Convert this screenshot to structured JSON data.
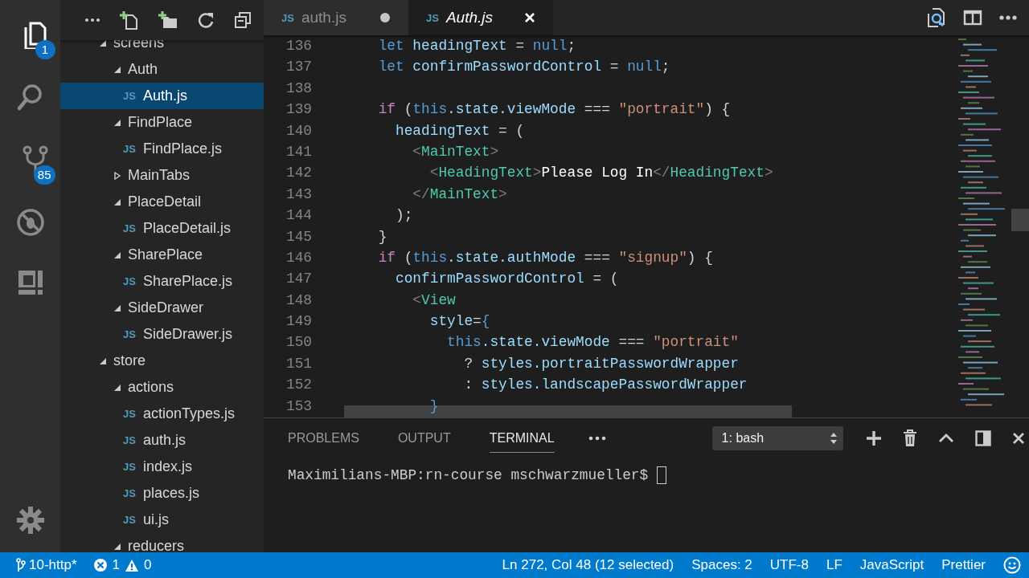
{
  "activity_bar": {
    "items": [
      {
        "kind": "explorer",
        "selected": true,
        "badge": "1"
      },
      {
        "kind": "search",
        "selected": false
      },
      {
        "kind": "source-control",
        "selected": false,
        "badge": "85"
      },
      {
        "kind": "debug",
        "selected": false
      },
      {
        "kind": "extensions",
        "selected": false
      }
    ]
  },
  "tree": [
    {
      "label": "screens",
      "kind": "folder",
      "expanded": true,
      "selected": false,
      "children": [
        {
          "label": "Auth",
          "kind": "folder",
          "expanded": true,
          "selected": false,
          "children": [
            {
              "label": "Auth.js",
              "kind": "file",
              "icon_label": "JS",
              "selected": true
            }
          ]
        },
        {
          "label": "FindPlace",
          "kind": "folder",
          "expanded": true,
          "selected": false,
          "children": [
            {
              "label": "FindPlace.js",
              "kind": "file",
              "icon_label": "JS",
              "selected": false
            }
          ]
        },
        {
          "label": "MainTabs",
          "kind": "folder",
          "expanded": false,
          "selected": false
        },
        {
          "label": "PlaceDetail",
          "kind": "folder",
          "expanded": true,
          "selected": false,
          "children": [
            {
              "label": "PlaceDetail.js",
              "kind": "file",
              "icon_label": "JS",
              "selected": false
            }
          ]
        },
        {
          "label": "SharePlace",
          "kind": "folder",
          "expanded": true,
          "selected": false,
          "children": [
            {
              "label": "SharePlace.js",
              "kind": "file",
              "icon_label": "JS",
              "selected": false
            }
          ]
        },
        {
          "label": "SideDrawer",
          "kind": "folder",
          "expanded": true,
          "selected": false,
          "children": [
            {
              "label": "SideDrawer.js",
              "kind": "file",
              "icon_label": "JS",
              "selected": false
            }
          ]
        }
      ]
    },
    {
      "label": "store",
      "kind": "folder",
      "expanded": true,
      "selected": false,
      "children": [
        {
          "label": "actions",
          "kind": "folder",
          "expanded": true,
          "selected": false,
          "children": [
            {
              "label": "actionTypes.js",
              "kind": "file",
              "icon_label": "JS",
              "selected": false
            },
            {
              "label": "auth.js",
              "kind": "file",
              "icon_label": "JS",
              "selected": false
            },
            {
              "label": "index.js",
              "kind": "file",
              "icon_label": "JS",
              "selected": false
            },
            {
              "label": "places.js",
              "kind": "file",
              "icon_label": "JS",
              "selected": false
            },
            {
              "label": "ui.js",
              "kind": "file",
              "icon_label": "JS",
              "selected": false
            }
          ]
        },
        {
          "label": "reducers",
          "kind": "folder",
          "expanded": true,
          "selected": false
        }
      ]
    }
  ],
  "editor_tabs": [
    {
      "label": "auth.js",
      "icon_label": "JS",
      "selected": false,
      "dirty": true,
      "preview": false
    },
    {
      "label": "Auth.js",
      "icon_label": "JS",
      "selected": true,
      "dirty": false,
      "preview": true
    }
  ],
  "code_lines": [
    {
      "number": "136",
      "tokens": [
        {
          "text": "    let",
          "kind": "keyword"
        },
        {
          "text": " headingText",
          "kind": "var"
        },
        {
          "text": " = ",
          "kind": "plain"
        },
        {
          "text": "null",
          "kind": "keyword"
        },
        {
          "text": ";",
          "kind": "plain"
        }
      ]
    },
    {
      "number": "137",
      "tokens": [
        {
          "text": "    let",
          "kind": "keyword"
        },
        {
          "text": " confirmPasswordControl",
          "kind": "var"
        },
        {
          "text": " = ",
          "kind": "plain"
        },
        {
          "text": "null",
          "kind": "keyword"
        },
        {
          "text": ";",
          "kind": "plain"
        }
      ]
    },
    {
      "number": "138"
    },
    {
      "number": "139",
      "tokens": [
        {
          "text": "    if",
          "kind": "control"
        },
        {
          "text": " (",
          "kind": "plain"
        },
        {
          "text": "this",
          "kind": "keyword"
        },
        {
          "text": ".state.viewMode",
          "kind": "var"
        },
        {
          "text": " === ",
          "kind": "plain"
        },
        {
          "text": "\"portrait\"",
          "kind": "string"
        },
        {
          "text": ") {",
          "kind": "plain"
        }
      ]
    },
    {
      "number": "140",
      "tokens": [
        {
          "text": "      headingText",
          "kind": "var"
        },
        {
          "text": " = (",
          "kind": "plain"
        }
      ]
    },
    {
      "number": "141",
      "tokens": [
        {
          "text": "        <",
          "kind": "bracket"
        },
        {
          "text": "MainText",
          "kind": "tag"
        },
        {
          "text": ">",
          "kind": "bracket"
        }
      ]
    },
    {
      "number": "142",
      "tokens": [
        {
          "text": "          <",
          "kind": "bracket"
        },
        {
          "text": "HeadingText",
          "kind": "tag"
        },
        {
          "text": ">",
          "kind": "bracket"
        },
        {
          "text": "Please Log In",
          "kind": "text"
        },
        {
          "text": "</",
          "kind": "bracket"
        },
        {
          "text": "HeadingText",
          "kind": "tag"
        },
        {
          "text": ">",
          "kind": "bracket"
        }
      ]
    },
    {
      "number": "143",
      "tokens": [
        {
          "text": "        </",
          "kind": "bracket"
        },
        {
          "text": "MainText",
          "kind": "tag"
        },
        {
          "text": ">",
          "kind": "bracket"
        }
      ]
    },
    {
      "number": "144",
      "tokens": [
        {
          "text": "      );",
          "kind": "plain"
        }
      ]
    },
    {
      "number": "145",
      "tokens": [
        {
          "text": "    }",
          "kind": "plain"
        }
      ]
    },
    {
      "number": "146",
      "tokens": [
        {
          "text": "    if",
          "kind": "control"
        },
        {
          "text": " (",
          "kind": "plain"
        },
        {
          "text": "this",
          "kind": "keyword"
        },
        {
          "text": ".state.authMode",
          "kind": "var"
        },
        {
          "text": " === ",
          "kind": "plain"
        },
        {
          "text": "\"signup\"",
          "kind": "string"
        },
        {
          "text": ") {",
          "kind": "plain"
        }
      ]
    },
    {
      "number": "147",
      "tokens": [
        {
          "text": "      confirmPasswordControl",
          "kind": "var"
        },
        {
          "text": " = (",
          "kind": "plain"
        }
      ]
    },
    {
      "number": "148",
      "tokens": [
        {
          "text": "        <",
          "kind": "bracket"
        },
        {
          "text": "View",
          "kind": "tag"
        }
      ]
    },
    {
      "number": "149",
      "tokens": [
        {
          "text": "          style",
          "kind": "var"
        },
        {
          "text": "=",
          "kind": "plain"
        },
        {
          "text": "{",
          "kind": "keyword"
        }
      ]
    },
    {
      "number": "150",
      "tokens": [
        {
          "text": "            this",
          "kind": "keyword"
        },
        {
          "text": ".state.viewMode",
          "kind": "var"
        },
        {
          "text": " === ",
          "kind": "plain"
        },
        {
          "text": "\"portrait\"",
          "kind": "string"
        }
      ]
    },
    {
      "number": "151",
      "tokens": [
        {
          "text": "              ? ",
          "kind": "plain"
        },
        {
          "text": "styles.portraitPasswordWrapper",
          "kind": "var"
        }
      ]
    },
    {
      "number": "152",
      "tokens": [
        {
          "text": "              : ",
          "kind": "plain"
        },
        {
          "text": "styles.landscapePasswordWrapper",
          "kind": "var"
        }
      ]
    },
    {
      "number": "153",
      "tokens": [
        {
          "text": "          }",
          "kind": "keyword"
        }
      ]
    }
  ],
  "panel": {
    "tabs": [
      {
        "label": "PROBLEMS",
        "selected": false
      },
      {
        "label": "OUTPUT",
        "selected": false
      },
      {
        "label": "TERMINAL",
        "selected": true
      }
    ],
    "terminal_select": {
      "value": "1: bash"
    },
    "terminal_lines": [
      "Maximilians-MBP:rn-course mschwarzmueller$ "
    ]
  },
  "status_bar": {
    "branch": "10-http*",
    "errors": "1",
    "warnings": "0",
    "right": [
      "Ln 272, Col 48 (12 selected)",
      "Spaces: 2",
      "UTF-8",
      "LF",
      "JavaScript",
      "Prettier"
    ]
  }
}
